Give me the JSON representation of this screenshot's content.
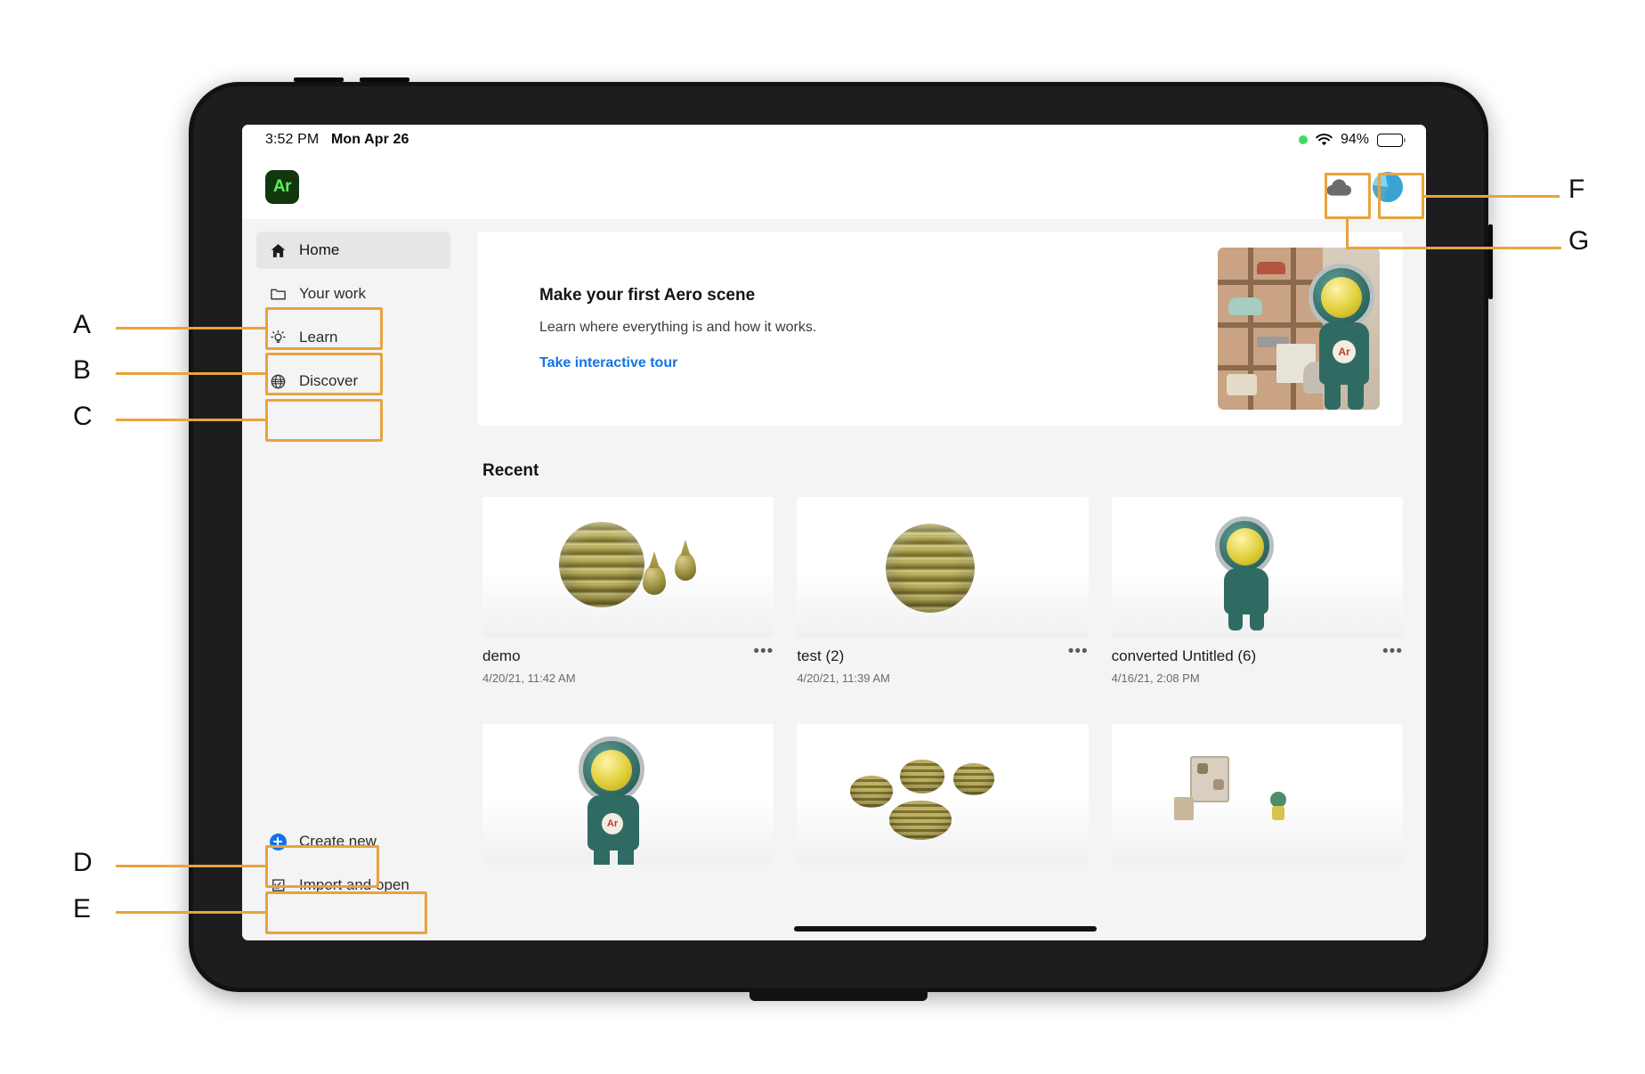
{
  "status_bar": {
    "time": "3:52 PM",
    "date": "Mon Apr 26",
    "battery_percent": "94%",
    "wifi_icon": "wifi-icon",
    "recording_dot": "green-status-dot",
    "battery_icon": "battery-icon"
  },
  "header": {
    "logo_text": "Ar",
    "logo_bg": "#12370f",
    "logo_fg": "#5fed5f",
    "cloud_icon": "cloud-icon",
    "avatar_icon": "user-avatar"
  },
  "sidebar": {
    "items": [
      {
        "label": "Home",
        "icon": "home-icon",
        "active": true
      },
      {
        "label": "Your work",
        "icon": "folder-icon",
        "active": false
      },
      {
        "label": "Learn",
        "icon": "lightbulb-icon",
        "active": false
      },
      {
        "label": "Discover",
        "icon": "globe-icon",
        "active": false
      }
    ],
    "bottom_items": [
      {
        "label": "Create new",
        "icon": "plus-circle-icon"
      },
      {
        "label": "Import and open",
        "icon": "import-arrow-icon"
      }
    ]
  },
  "hero": {
    "title": "Make your first Aero scene",
    "subtitle": "Learn where everything is and how it works.",
    "link": "Take interactive tour",
    "link_color": "#1473e6",
    "thumbnail": "toy-shop-astronaut-scene"
  },
  "recent": {
    "section_title": "Recent",
    "overflow_glyph": "•••",
    "cards": [
      {
        "name": "demo",
        "date": "4/20/21, 11:42 AM",
        "thumb": "gold-coil-sphere-with-droplets"
      },
      {
        "name": "test (2)",
        "date": "4/20/21, 11:39 AM",
        "thumb": "gold-coil-sphere"
      },
      {
        "name": "converted Untitled (6)",
        "date": "4/16/21, 2:08 PM",
        "thumb": "teal-astronaut-figure"
      },
      {
        "name": "",
        "date": "",
        "thumb": "teal-astronaut-figure-full"
      },
      {
        "name": "",
        "date": "",
        "thumb": "gold-spiral-ribbons"
      },
      {
        "name": "",
        "date": "",
        "thumb": "miniature-shelf-scene"
      }
    ]
  },
  "annotations": {
    "accent_color": "#e8a33d",
    "labels": [
      {
        "id": "A",
        "target": "Your work"
      },
      {
        "id": "B",
        "target": "Learn"
      },
      {
        "id": "C",
        "target": "Discover"
      },
      {
        "id": "D",
        "target": "Create new"
      },
      {
        "id": "E",
        "target": "Import and open"
      },
      {
        "id": "F",
        "target": "user-avatar"
      },
      {
        "id": "G",
        "target": "cloud-icon"
      }
    ]
  }
}
